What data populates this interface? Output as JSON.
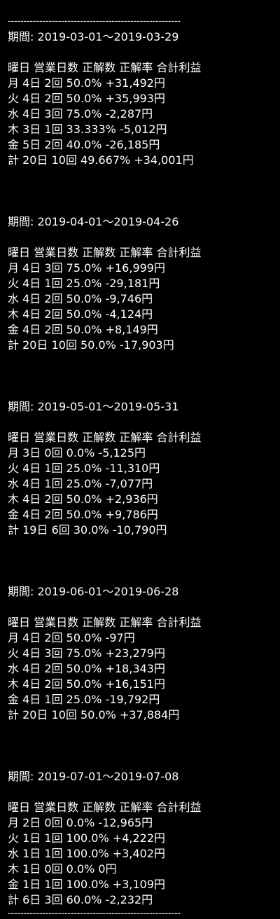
{
  "rule_top": "-------------------------------------------------------",
  "rule_bottom": "-------------------------------------------------------",
  "header": [
    "曜日",
    "営業日数",
    "正解数",
    "正解率",
    "合計利益"
  ],
  "periods": [
    {
      "title": "期間: 2019-03-01〜2019-03-29",
      "rows": [
        [
          "月",
          "4日",
          "2回",
          "50.0%",
          "+31,492円"
        ],
        [
          "火",
          "4日",
          "2回",
          "50.0%",
          "+35,993円"
        ],
        [
          "水",
          "4日",
          "3回",
          "75.0%",
          "-2,287円"
        ],
        [
          "木",
          "3日",
          "1回",
          "33.333%",
          "-5,012円"
        ],
        [
          "金",
          "5日",
          "2回",
          "40.0%",
          "-26,185円"
        ],
        [
          "計",
          "20日",
          "10回",
          "49.667%",
          "+34,001円"
        ]
      ]
    },
    {
      "title": "期間: 2019-04-01〜2019-04-26",
      "rows": [
        [
          "月",
          "4日",
          "3回",
          "75.0%",
          "+16,999円"
        ],
        [
          "火",
          "4日",
          "1回",
          "25.0%",
          "-29,181円"
        ],
        [
          "水",
          "4日",
          "2回",
          "50.0%",
          "-9,746円"
        ],
        [
          "木",
          "4日",
          "2回",
          "50.0%",
          "-4,124円"
        ],
        [
          "金",
          "4日",
          "2回",
          "50.0%",
          "+8,149円"
        ],
        [
          "計",
          "20日",
          "10回",
          "50.0%",
          "-17,903円"
        ]
      ]
    },
    {
      "title": "期間: 2019-05-01〜2019-05-31",
      "rows": [
        [
          "月",
          "3日",
          "0回",
          "0.0%",
          "-5,125円"
        ],
        [
          "火",
          "4日",
          "1回",
          "25.0%",
          "-11,310円"
        ],
        [
          "水",
          "4日",
          "1回",
          "25.0%",
          "-7,077円"
        ],
        [
          "木",
          "4日",
          "2回",
          "50.0%",
          "+2,936円"
        ],
        [
          "金",
          "4日",
          "2回",
          "50.0%",
          "+9,786円"
        ],
        [
          "計",
          "19日",
          "6回",
          "30.0%",
          "-10,790円"
        ]
      ]
    },
    {
      "title": "期間: 2019-06-01〜2019-06-28",
      "rows": [
        [
          "月",
          "4日",
          "2回",
          "50.0%",
          "-97円"
        ],
        [
          "火",
          "4日",
          "3回",
          "75.0%",
          "+23,279円"
        ],
        [
          "水",
          "4日",
          "2回",
          "50.0%",
          "+18,343円"
        ],
        [
          "木",
          "4日",
          "2回",
          "50.0%",
          "+16,151円"
        ],
        [
          "金",
          "4日",
          "1回",
          "25.0%",
          "-19,792円"
        ],
        [
          "計",
          "20日",
          "10回",
          "50.0%",
          "+37,884円"
        ]
      ]
    },
    {
      "title": "期間: 2019-07-01〜2019-07-08",
      "rows": [
        [
          "月",
          "2日",
          "0回",
          "0.0%",
          "-12,965円"
        ],
        [
          "火",
          "1日",
          "1回",
          "100.0%",
          "+4,222円"
        ],
        [
          "水",
          "1日",
          "1回",
          "100.0%",
          "+3,402円"
        ],
        [
          "木",
          "1日",
          "0回",
          "0.0%",
          "0円"
        ],
        [
          "金",
          "1日",
          "1回",
          "100.0%",
          "+3,109円"
        ],
        [
          "計",
          "6日",
          "3回",
          "60.0%",
          "-2,232円"
        ]
      ]
    }
  ]
}
